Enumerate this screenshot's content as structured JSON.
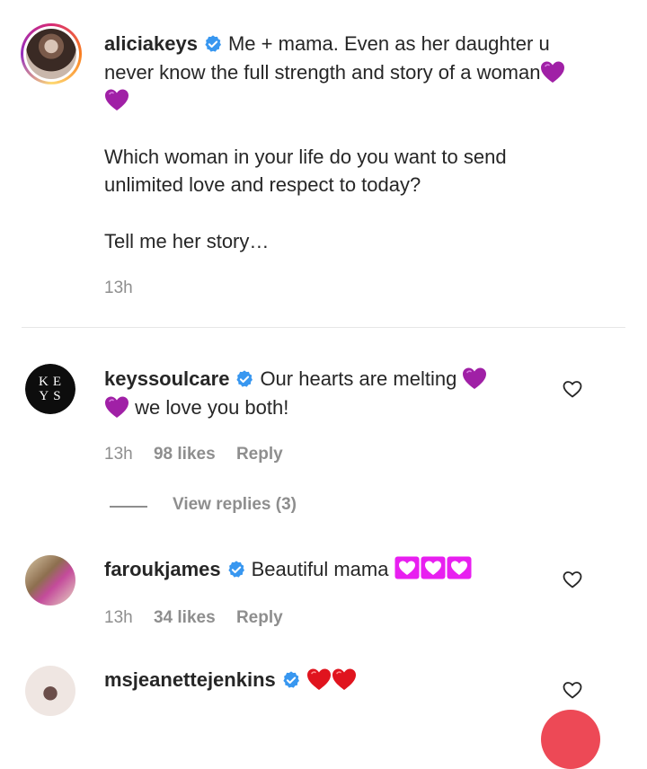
{
  "post": {
    "username": "aliciakeys",
    "caption_line1": "Me + mama. Even as her daughter u never know the full strength and story of a woman",
    "caption_emojis": [
      "purple-heart",
      "purple-heart"
    ],
    "caption_para2": "Which woman in your life do you want to send unlimited love and respect to today?",
    "caption_para3": "Tell me her story…",
    "time": "13h"
  },
  "comments": [
    {
      "username": "keyssoulcare",
      "avatar_text_top": "KE",
      "avatar_text_bottom": "YS",
      "text_a": "Our hearts are melting",
      "text_b": "we love you both!",
      "time": "13h",
      "likes": "98 likes",
      "reply": "Reply",
      "view_replies": "View replies (3)"
    },
    {
      "username": "faroukjames",
      "text": "Beautiful mama",
      "time": "13h",
      "likes": "34 likes",
      "reply": "Reply"
    },
    {
      "username": "msjeanettejenkins",
      "emojis": [
        "red-heart",
        "red-heart"
      ]
    }
  ],
  "colors": {
    "verified": "#3897f0",
    "purple_heart": "#a020a6",
    "pink_box": "#e81ff0",
    "red_heart": "#e0141e",
    "muted": "#8e8e8e"
  }
}
